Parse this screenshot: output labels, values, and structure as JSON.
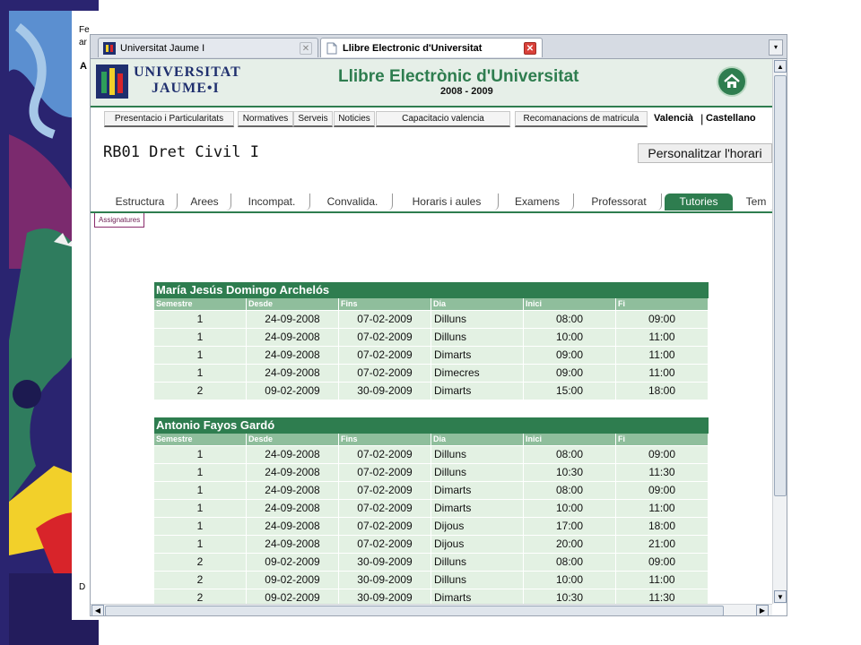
{
  "browser": {
    "tabs": [
      {
        "title": "Universitat Jaume I",
        "active": false
      },
      {
        "title": "Llibre Electronic d'Universitat",
        "active": true
      }
    ],
    "tab_list_glyph": "▾"
  },
  "header": {
    "logo_line1": "UNIVERSITAT",
    "logo_line2": "JAUME•I",
    "site_title": "Llibre Electrònic d'Universitat",
    "years": "2008 - 2009",
    "home_icon": "home-icon"
  },
  "nav": {
    "items": [
      "Presentacio i Particularitats",
      "Normatives",
      "Serveis",
      "Noticies",
      "Capacitacio valencia",
      "Recomanacions de matricula"
    ],
    "lang_valencia": "Valencià",
    "lang_sep": "|",
    "lang_castellano": "Castellano"
  },
  "page": {
    "title": "RB01 Dret Civil I",
    "personalize_button": "Personalitzar l'horari"
  },
  "subtabs": {
    "items": [
      "Estructura",
      "Arees",
      "Incompat.",
      "Convalida.",
      "Horaris i aules",
      "Examens",
      "Professorat",
      "Tutories",
      "Tem"
    ],
    "active": "Tutories",
    "assignatures_label": "Assignatures"
  },
  "columns": [
    "Semestre",
    "Desde",
    "Fins",
    "Dia",
    "Inici",
    "Fi"
  ],
  "professors": [
    {
      "name": "María Jesús Domingo Archelós",
      "rows": [
        [
          "1",
          "24-09-2008",
          "07-02-2009",
          "Dilluns",
          "08:00",
          "09:00"
        ],
        [
          "1",
          "24-09-2008",
          "07-02-2009",
          "Dilluns",
          "10:00",
          "11:00"
        ],
        [
          "1",
          "24-09-2008",
          "07-02-2009",
          "Dimarts",
          "09:00",
          "11:00"
        ],
        [
          "1",
          "24-09-2008",
          "07-02-2009",
          "Dimecres",
          "09:00",
          "11:00"
        ],
        [
          "2",
          "09-02-2009",
          "30-09-2009",
          "Dimarts",
          "15:00",
          "18:00"
        ]
      ]
    },
    {
      "name": "Antonio Fayos Gardó",
      "rows": [
        [
          "1",
          "24-09-2008",
          "07-02-2009",
          "Dilluns",
          "08:00",
          "09:00"
        ],
        [
          "1",
          "24-09-2008",
          "07-02-2009",
          "Dilluns",
          "10:30",
          "11:30"
        ],
        [
          "1",
          "24-09-2008",
          "07-02-2009",
          "Dimarts",
          "08:00",
          "09:00"
        ],
        [
          "1",
          "24-09-2008",
          "07-02-2009",
          "Dimarts",
          "10:00",
          "11:00"
        ],
        [
          "1",
          "24-09-2008",
          "07-02-2009",
          "Dijous",
          "17:00",
          "18:00"
        ],
        [
          "1",
          "24-09-2008",
          "07-02-2009",
          "Dijous",
          "20:00",
          "21:00"
        ],
        [
          "2",
          "09-02-2009",
          "30-09-2009",
          "Dilluns",
          "08:00",
          "09:00"
        ],
        [
          "2",
          "09-02-2009",
          "30-09-2009",
          "Dilluns",
          "10:00",
          "11:00"
        ],
        [
          "2",
          "09-02-2009",
          "30-09-2009",
          "Dimarts",
          "10:30",
          "11:30"
        ]
      ]
    }
  ],
  "background": {
    "bg_text_1": "Fe",
    "bg_text_2": "ar",
    "bg_text_3": "A",
    "bg_text_4": "D"
  },
  "colors": {
    "accent": "#2e7d4f",
    "header_bg": "#e6efe8",
    "row_bg": "#e3f1e3",
    "col_header": "#8fbe9c"
  }
}
